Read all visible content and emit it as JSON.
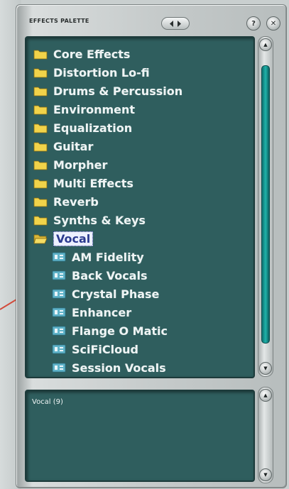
{
  "window": {
    "title": "EFFECTS PALETTE"
  },
  "tree": {
    "folders": [
      {
        "label": "Core Effects"
      },
      {
        "label": "Distortion Lo-fi"
      },
      {
        "label": "Drums & Percussion"
      },
      {
        "label": "Environment"
      },
      {
        "label": "Equalization"
      },
      {
        "label": "Guitar"
      },
      {
        "label": "Morpher"
      },
      {
        "label": "Multi Effects"
      },
      {
        "label": "Reverb"
      },
      {
        "label": "Synths & Keys"
      },
      {
        "label": "Vocal",
        "expanded": true,
        "selected": true
      }
    ],
    "vocal_effects": [
      {
        "label": "AM Fidelity"
      },
      {
        "label": "Back Vocals"
      },
      {
        "label": "Crystal Phase"
      },
      {
        "label": "Enhancer"
      },
      {
        "label": "Flange O Matic"
      },
      {
        "label": "SciFiCloud"
      },
      {
        "label": "Session Vocals"
      }
    ]
  },
  "info": {
    "text": "Vocal (9)"
  },
  "icons": {
    "folder": "folder-icon",
    "folder_open": "folder-open-icon",
    "effect": "effect-plugin-icon",
    "help": "help-icon",
    "close": "close-icon"
  },
  "colors": {
    "panel_bg": "#2f5e5e",
    "selection_bg": "#ecf0ff",
    "folder": "#f1d34a",
    "effect_icon": "#5fb3c9",
    "scroll_thumb": "#1fb2aa",
    "annotation_line": "#d24a3a"
  }
}
